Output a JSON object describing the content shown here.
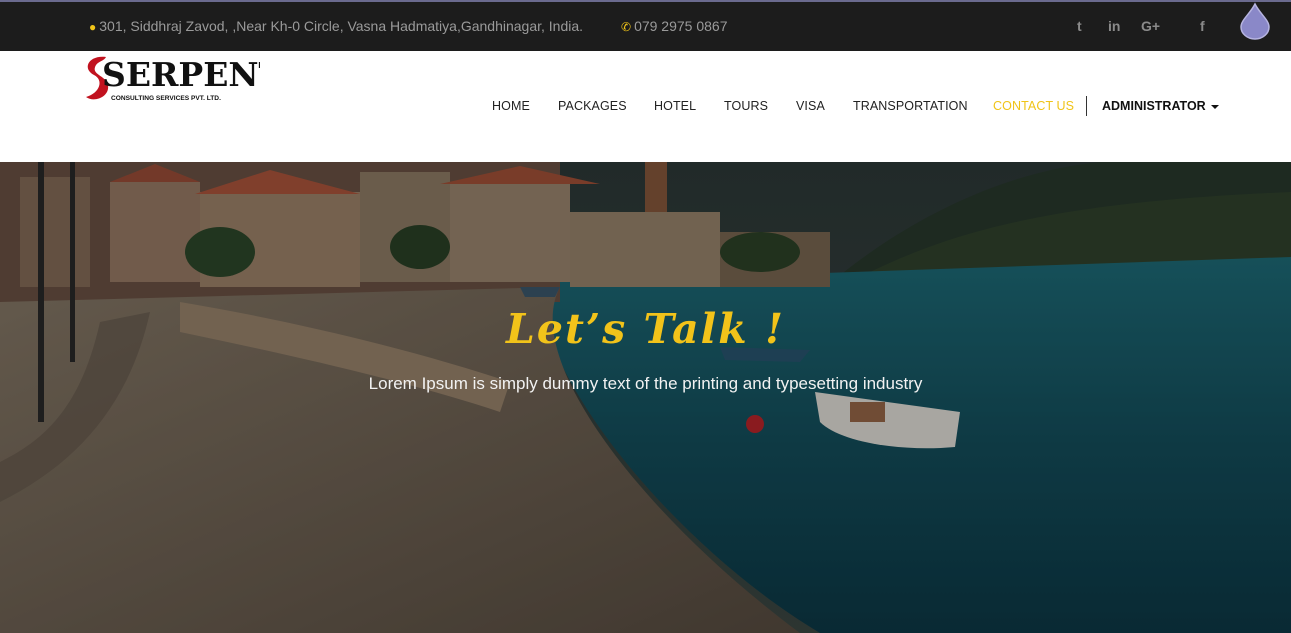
{
  "topbar": {
    "address": "301, Siddhraj Zavod, ,Near Kh-0 Circle, Vasna Hadmatiya,Gandhinagar, India.",
    "phone": "079 2975 0867",
    "social": {
      "twitter": "t",
      "linkedin": "in",
      "googleplus": "G+",
      "facebook": "f"
    }
  },
  "logo": {
    "title": "SERPENT",
    "subtitle": "CONSULTING SERVICES PVT. LTD."
  },
  "nav": {
    "items": [
      "HOME",
      "PACKAGES",
      "HOTEL",
      "TOURS",
      "VISA",
      "TRANSPORTATION",
      "CONTACT US"
    ],
    "active": "CONTACT US",
    "user": "ADMINISTRATOR"
  },
  "hero": {
    "title": "Let’s Talk !",
    "subtitle": "Lorem Ipsum is simply dummy text of the printing and typesetting industry"
  },
  "colors": {
    "accent": "#f0c419",
    "topbar_bg": "#1c1c1c",
    "logo_red": "#c1121f"
  },
  "icons": [
    "map-marker-icon",
    "phone-icon",
    "twitter-icon",
    "linkedin-icon",
    "google-plus-icon",
    "facebook-icon",
    "drop-icon",
    "caret-down-icon"
  ]
}
